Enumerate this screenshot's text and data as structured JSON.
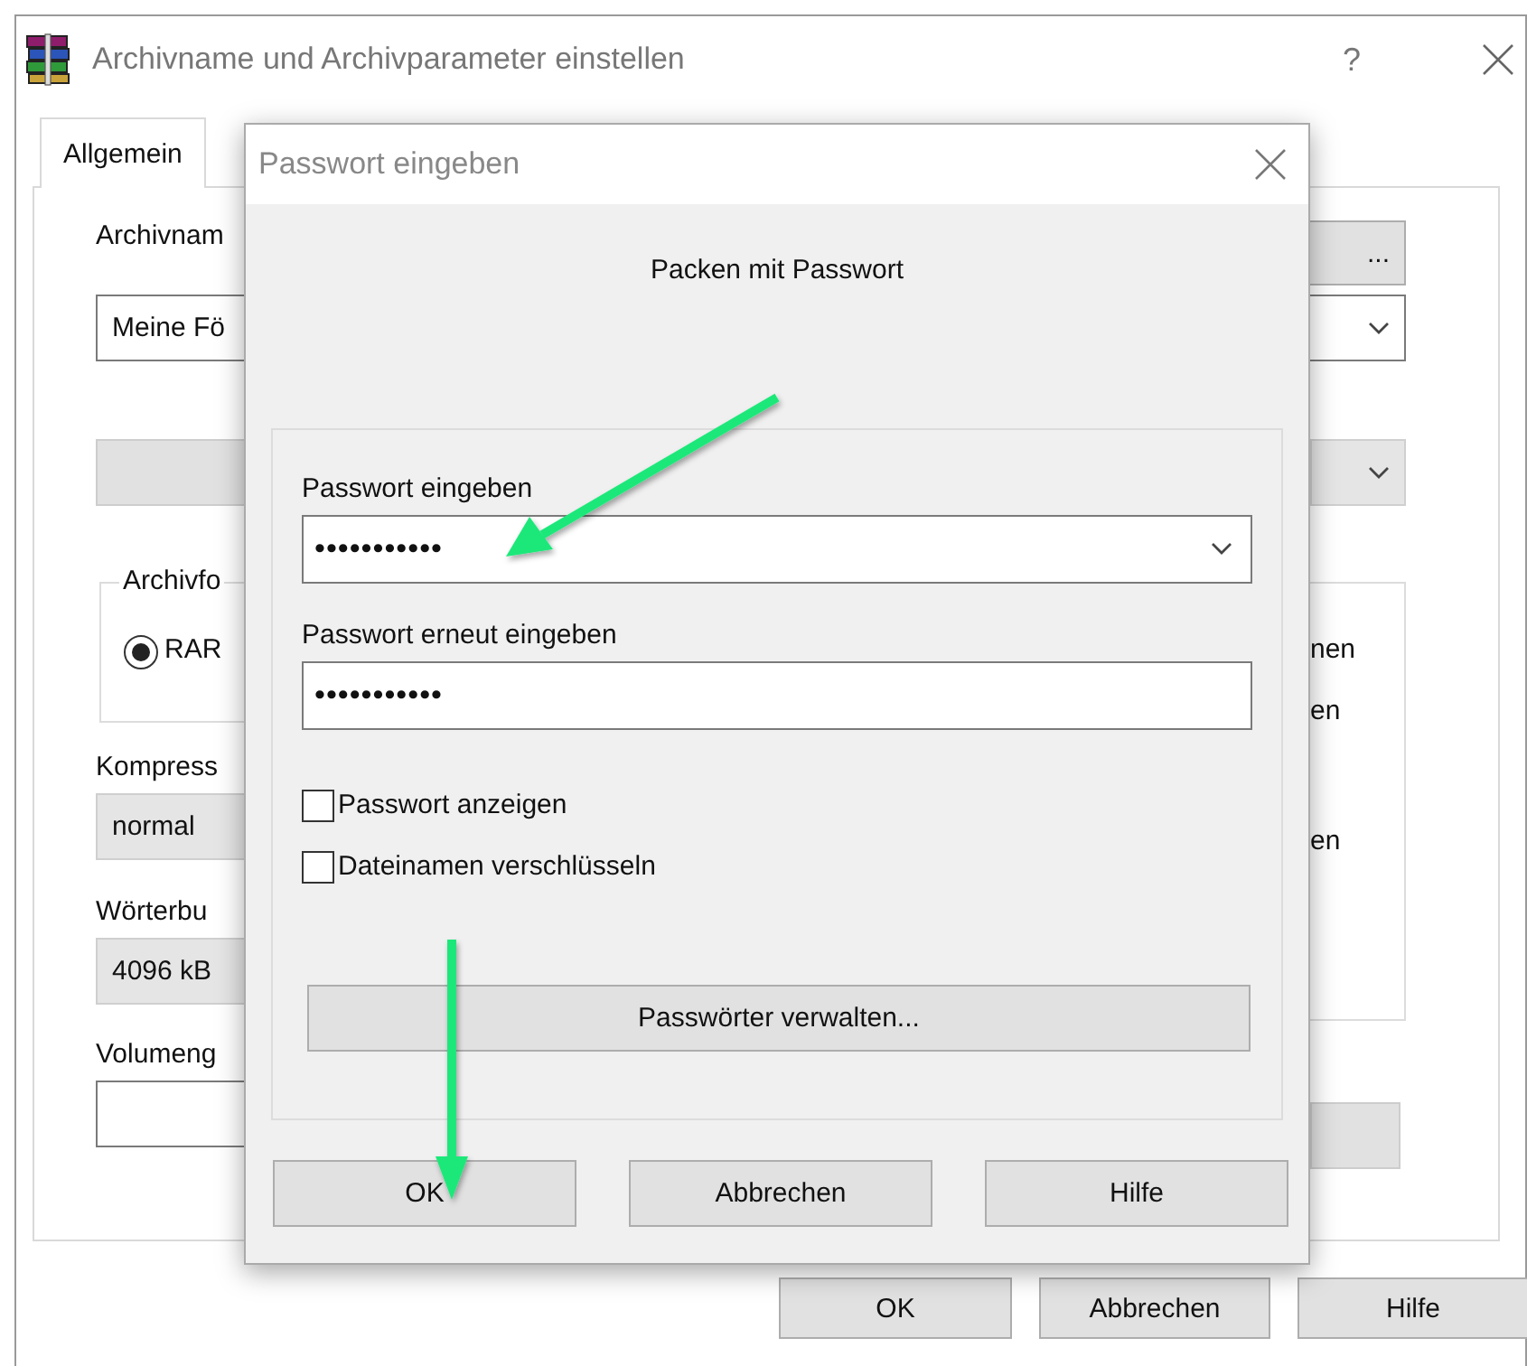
{
  "window": {
    "title": "Archivname und Archivparameter einstellen",
    "help": "?"
  },
  "tabs": [
    {
      "label": "Allgemein",
      "selected": true
    }
  ],
  "general": {
    "archive_name_label": "Archivnam",
    "browse_button": "...",
    "archive_name_value": "Meine Fö",
    "format_group_label": "Archivfo",
    "format_options": [
      {
        "label": "RAR",
        "selected": true
      }
    ],
    "compression_label": "Kompress",
    "compression_value": "normal",
    "dictionary_label": "Wörterbu",
    "dictionary_value": "4096 kB",
    "volume_label": "Volumeng",
    "options_texts": [
      "nen",
      "en",
      "en"
    ]
  },
  "buttons": [
    {
      "label": "OK"
    },
    {
      "label": "Abbrechen"
    },
    {
      "label": "Hilfe"
    }
  ],
  "password_dialog": {
    "title": "Passwort eingeben",
    "heading": "Packen mit Passwort",
    "password_label": "Passwort eingeben",
    "password_value": "•••••••••••",
    "repeat_label": "Passwort erneut eingeben",
    "repeat_value": "•••••••••••",
    "checkboxes": [
      {
        "label": "Passwort anzeigen",
        "checked": false
      },
      {
        "label": "Dateinamen verschlüsseln",
        "checked": false
      }
    ],
    "manage_button": "Passwörter verwalten...",
    "buttons": [
      {
        "label": "OK"
      },
      {
        "label": "Abbrechen"
      },
      {
        "label": "Hilfe"
      }
    ]
  }
}
